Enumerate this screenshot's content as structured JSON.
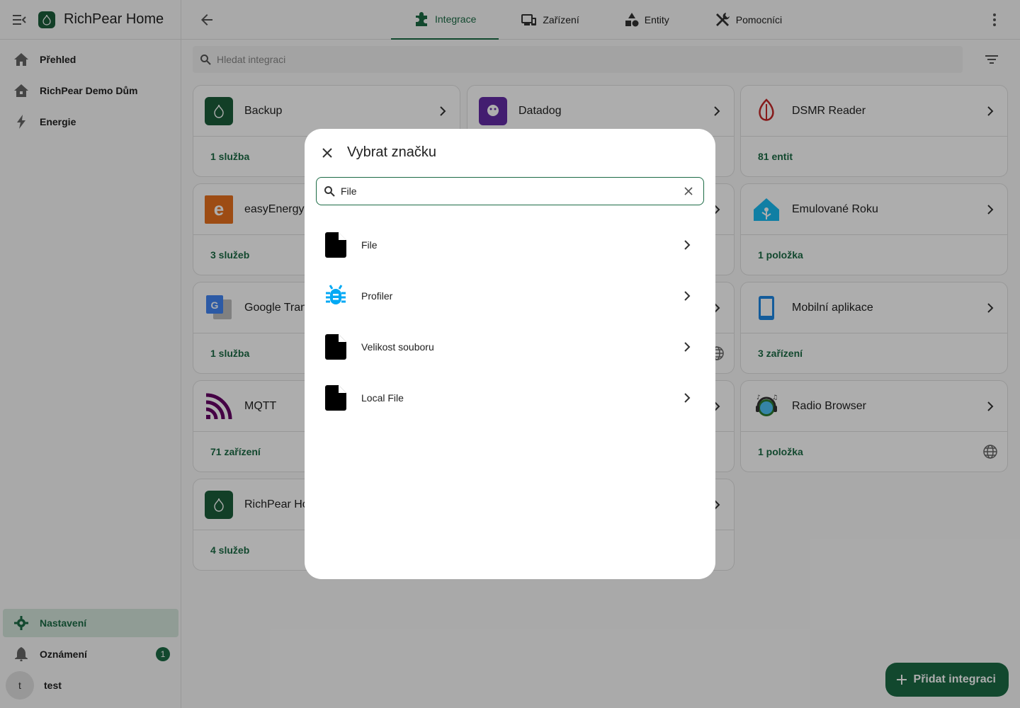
{
  "app": {
    "title": "RichPear Home"
  },
  "sidebar": {
    "items": [
      {
        "label": "Přehled",
        "icon": "home-icon"
      },
      {
        "label": "RichPear Demo Dům",
        "icon": "house-icon"
      },
      {
        "label": "Energie",
        "icon": "lightning-icon"
      }
    ],
    "bottom": [
      {
        "label": "Nastavení",
        "icon": "gear-icon",
        "active": true
      },
      {
        "label": "Oznámení",
        "icon": "bell-icon",
        "badge": "1"
      },
      {
        "label": "test",
        "avatar": "t"
      }
    ]
  },
  "header": {
    "tabs": [
      {
        "label": "Integrace",
        "icon": "puzzle-icon",
        "active": true
      },
      {
        "label": "Zařízení",
        "icon": "devices-icon"
      },
      {
        "label": "Entity",
        "icon": "shapes-icon"
      },
      {
        "label": "Pomocníci",
        "icon": "tools-icon"
      }
    ]
  },
  "search": {
    "placeholder": "Hledat integraci"
  },
  "cards": [
    {
      "name": "Backup",
      "footer": "1 služba"
    },
    {
      "name": "Datadog",
      "footer": ""
    },
    {
      "name": "DSMR Reader",
      "footer": "81 entit"
    },
    {
      "name": "easyEnergy",
      "footer": "3 služeb"
    },
    {
      "name": "Emulované Roku",
      "footer": "1 položka"
    },
    {
      "name": "Google Tran",
      "footer": "1 služba"
    },
    {
      "name": "Mobilní aplikace",
      "footer": "3 zařízení"
    },
    {
      "name": "MQTT",
      "footer": "71 zařízení"
    },
    {
      "name": "Radio Browser",
      "footer": "1 položka"
    },
    {
      "name": "RichPear Ho",
      "footer": "4 služeb"
    }
  ],
  "fab": {
    "label": "Přidat integraci"
  },
  "dialog": {
    "title": "Vybrat značku",
    "search_value": "File",
    "brands": [
      {
        "label": "File",
        "icon": "file-icon"
      },
      {
        "label": "Profiler",
        "icon": "bug-icon"
      },
      {
        "label": "Velikost souboru",
        "icon": "file-icon"
      },
      {
        "label": "Local File",
        "icon": "file-icon"
      }
    ]
  },
  "colors": {
    "primary": "#1b6b45",
    "accent_blue": "#03a9f4"
  }
}
